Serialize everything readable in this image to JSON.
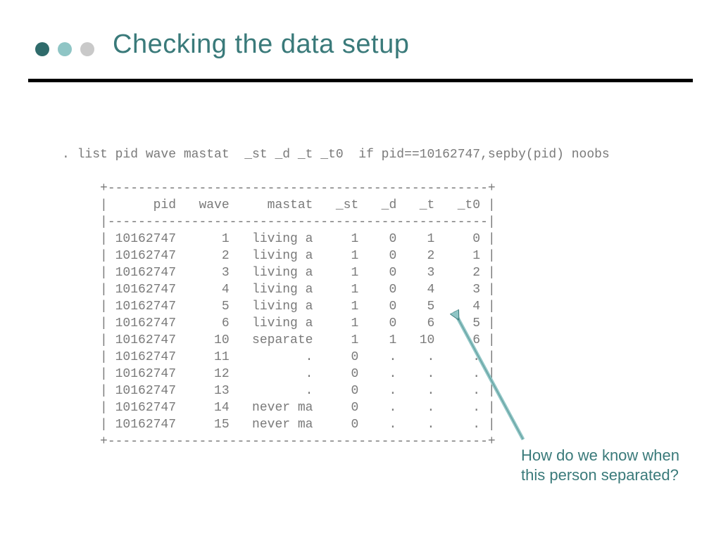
{
  "title": "Checking the data setup",
  "command": ". list pid wave mastat  _st _d _t _t0  if pid==10162747,sepby(pid) noobs",
  "table": {
    "border_top": "+--------------------------------------------------+",
    "header": "|      pid   wave     mastat   _st   _d   _t   _t0 |",
    "header_sep": "|--------------------------------------------------|",
    "rows": [
      "| 10162747      1   living a     1    0    1     0 |",
      "| 10162747      2   living a     1    0    2     1 |",
      "| 10162747      3   living a     1    0    3     2 |",
      "| 10162747      4   living a     1    0    4     3 |",
      "| 10162747      5   living a     1    0    5     4 |",
      "| 10162747      6   living a     1    0    6     5 |",
      "| 10162747     10   separate     1    1   10     6 |",
      "| 10162747     11          .     0    .    .     . |",
      "| 10162747     12          .     0    .    .     . |",
      "| 10162747     13          .     0    .    .     . |",
      "| 10162747     14   never ma     0    .    .     . |",
      "| 10162747     15   never ma     0    .    .     . |"
    ],
    "border_bottom": "+--------------------------------------------------+"
  },
  "annotation": {
    "line1": "How do we know when",
    "line2": "this person separated?"
  },
  "colors": {
    "accent": "#3a7a7a",
    "dot_dark": "#2f6b6b",
    "dot_light": "#8fc5c5",
    "dot_grey": "#c9c9c9",
    "code_grey": "#7a7a7a"
  }
}
